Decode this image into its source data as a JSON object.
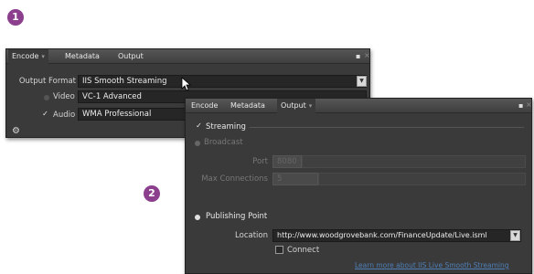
{
  "badges": [
    "1",
    "2"
  ],
  "panel1": {
    "tabs": [
      "Encode",
      "Metadata",
      "Output"
    ],
    "output_format_label": "Output Format",
    "output_format_value": "IIS Smooth Streaming",
    "video_label": "Video",
    "video_value": "VC-1 Advanced",
    "audio_label": "Audio",
    "audio_value": "WMA Professional",
    "audio_checked": "✓"
  },
  "panel2": {
    "tabs": [
      "Encode",
      "Metadata",
      "Output"
    ],
    "streaming_label": "Streaming",
    "streaming_checked": "✓",
    "broadcast_label": "Broadcast",
    "port_label": "Port",
    "port_value": "8080",
    "max_connections_label": "Max Connections",
    "max_connections_value": "5",
    "publishing_point_label": "Publishing Point",
    "location_label": "Location",
    "location_value": "http://www.woodgrovebank.com/FinanceUpdate/Live.isml",
    "connect_label": "Connect",
    "link_text": "Learn more about IIS Live Smooth Streaming"
  },
  "colors": {
    "badge": "#8b3f8d",
    "panel": "#3a3a3a",
    "link": "#4e7fb8"
  }
}
